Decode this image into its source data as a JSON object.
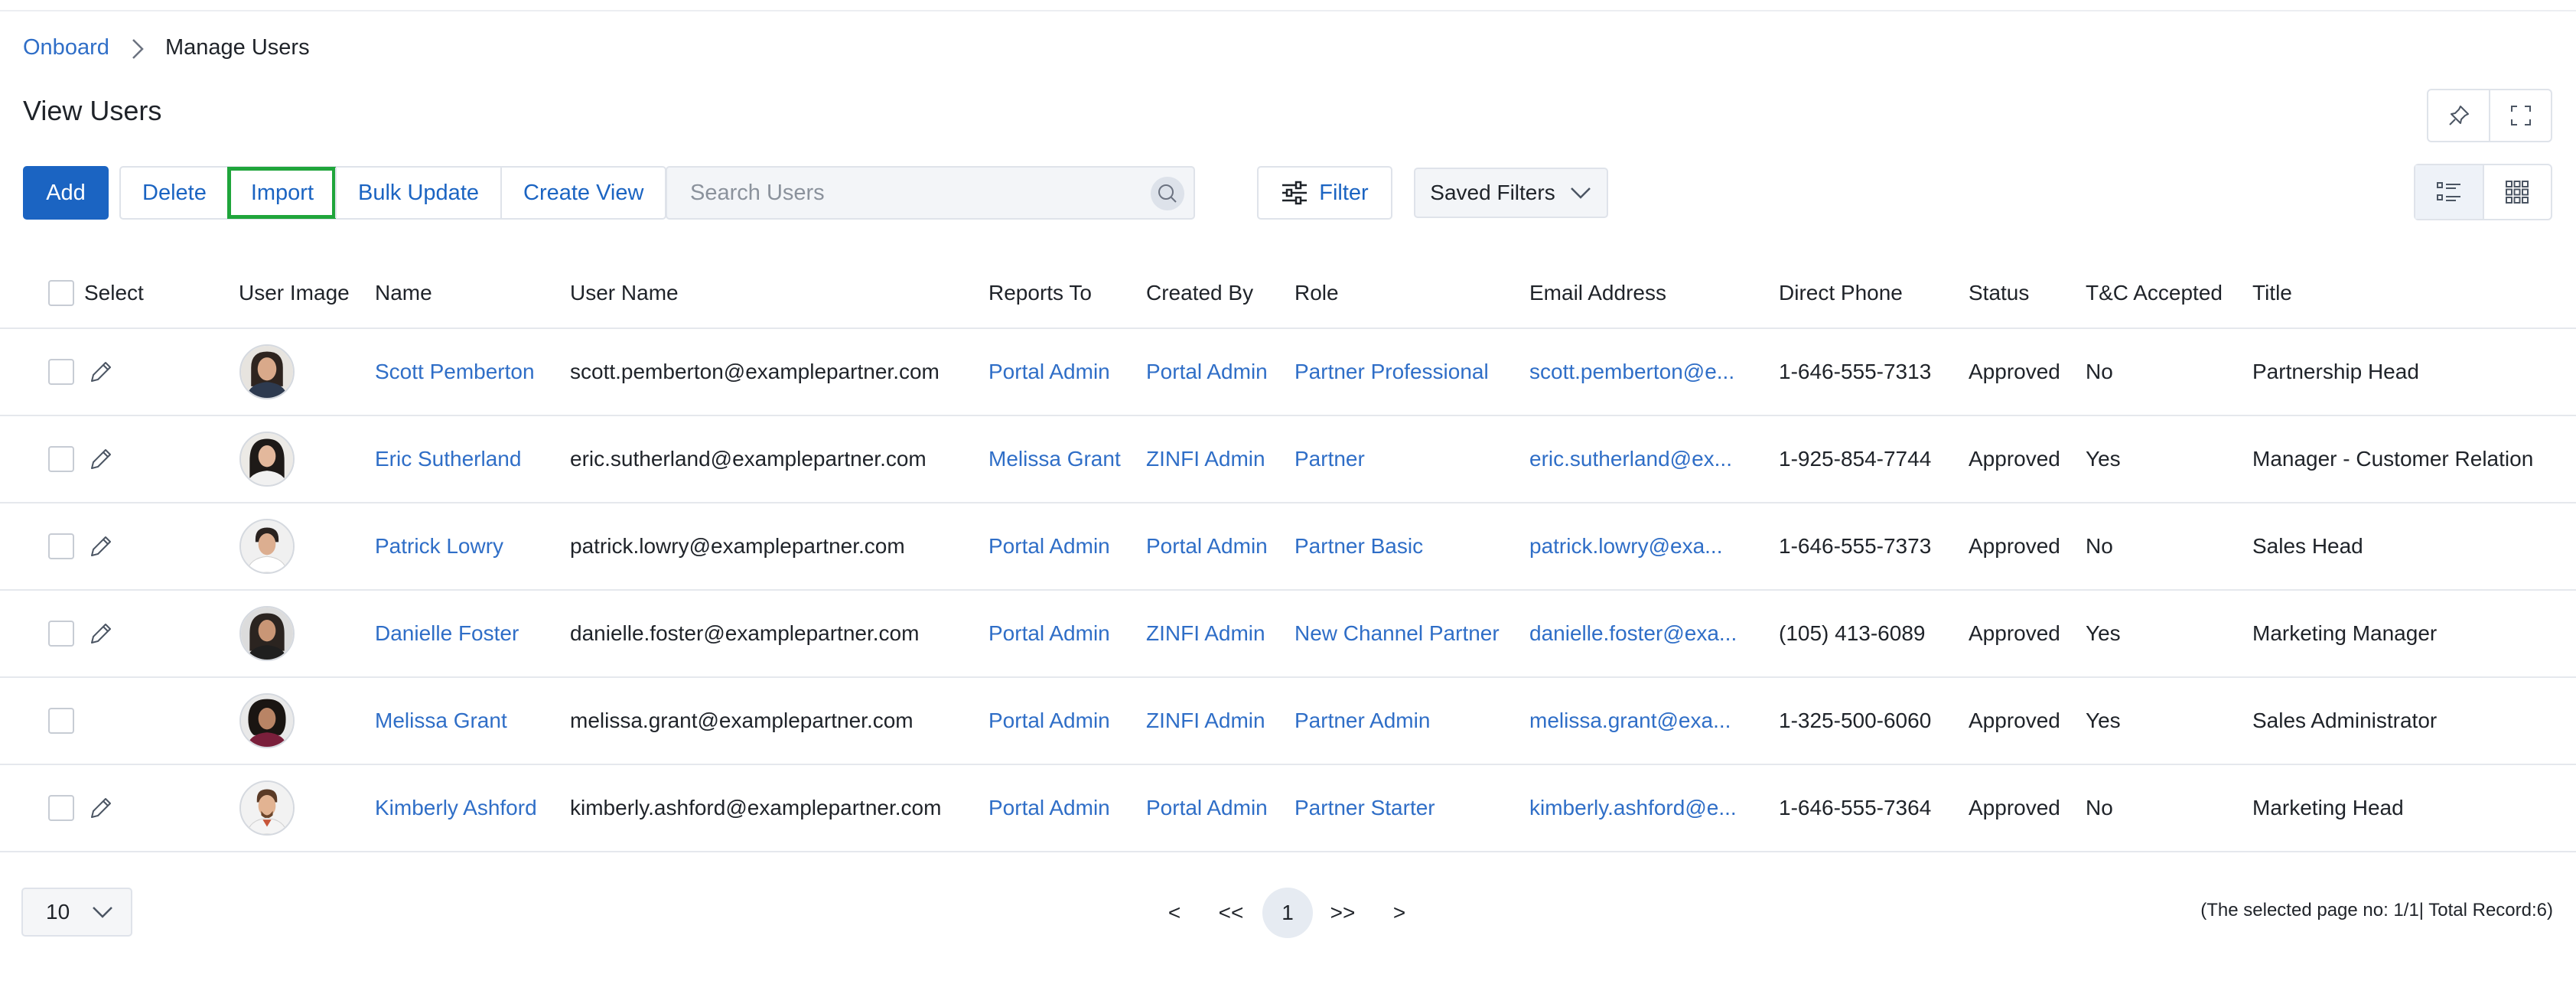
{
  "breadcrumb": {
    "root": "Onboard",
    "current": "Manage Users"
  },
  "page": {
    "title": "View Users"
  },
  "toolbar": {
    "add": "Add",
    "delete": "Delete",
    "import": "Import",
    "bulk_update": "Bulk Update",
    "create_view": "Create View",
    "search_placeholder": "Search Users",
    "filter": "Filter",
    "saved_filters": "Saved Filters"
  },
  "table": {
    "headers": {
      "select": "Select",
      "user_image": "User Image",
      "name": "Name",
      "user_name": "User Name",
      "reports_to": "Reports To",
      "created_by": "Created By",
      "role": "Role",
      "email": "Email Address",
      "phone": "Direct Phone",
      "status": "Status",
      "tc": "T&C Accepted",
      "title": "Title"
    },
    "rows": [
      {
        "name": "Scott Pemberton",
        "user_name": "scott.pemberton@examplepartner.com",
        "reports_to": "Portal Admin",
        "created_by": "Portal Admin",
        "role": "Partner Professional",
        "email": "scott.pemberton@e...",
        "phone": "1-646-555-7313",
        "status": "Approved",
        "tc": "No",
        "title": "Partnership Head"
      },
      {
        "name": "Eric Sutherland",
        "user_name": "eric.sutherland@examplepartner.com",
        "reports_to": "Melissa Grant",
        "created_by": "ZINFI Admin",
        "role": "Partner",
        "email": "eric.sutherland@ex...",
        "phone": "1-925-854-7744",
        "status": "Approved",
        "tc": "Yes",
        "title": "Manager - Customer Relation"
      },
      {
        "name": "Patrick Lowry",
        "user_name": "patrick.lowry@examplepartner.com",
        "reports_to": "Portal Admin",
        "created_by": "Portal Admin",
        "role": "Partner Basic",
        "email": "patrick.lowry@exa...",
        "phone": "1-646-555-7373",
        "status": "Approved",
        "tc": "No",
        "title": "Sales Head"
      },
      {
        "name": "Danielle Foster",
        "user_name": "danielle.foster@examplepartner.com",
        "reports_to": "Portal Admin",
        "created_by": "ZINFI Admin",
        "role": "New Channel Partner",
        "email": "danielle.foster@exa...",
        "phone": "(105) 413-6089",
        "status": "Approved",
        "tc": "Yes",
        "title": "Marketing Manager"
      },
      {
        "name": "Melissa Grant",
        "user_name": "melissa.grant@examplepartner.com",
        "reports_to": "Portal Admin",
        "created_by": "ZINFI Admin",
        "role": "Partner Admin",
        "email": "melissa.grant@exa...",
        "phone": "1-325-500-6060",
        "status": "Approved",
        "tc": "Yes",
        "title": "Sales Administrator"
      },
      {
        "name": "Kimberly Ashford",
        "user_name": "kimberly.ashford@examplepartner.com",
        "reports_to": "Portal Admin",
        "created_by": "Portal Admin",
        "role": "Partner Starter",
        "email": "kimberly.ashford@e...",
        "phone": "1-646-555-7364",
        "status": "Approved",
        "tc": "No",
        "title": "Marketing Head"
      }
    ]
  },
  "pagination": {
    "page_size": "10",
    "prev": "<",
    "first": "<<",
    "current": "1",
    "last": ">>",
    "next": ">",
    "info": "(The selected page no: 1/1| Total Record:6)"
  }
}
